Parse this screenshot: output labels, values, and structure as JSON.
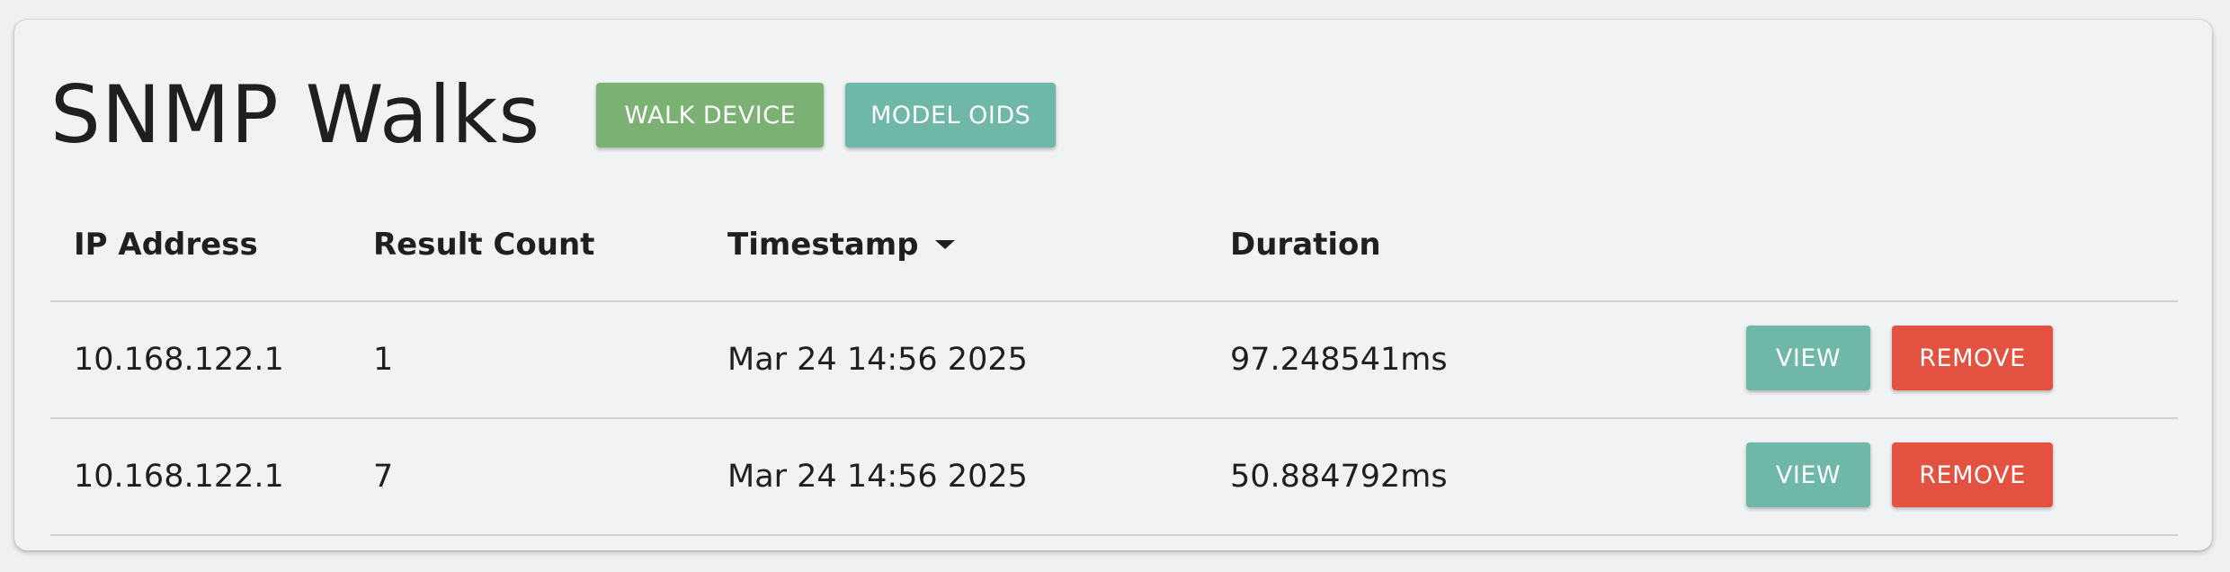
{
  "page": {
    "title": "SNMP Walks"
  },
  "toolbar": {
    "walk_device_label": "WALK DEVICE",
    "model_oids_label": "MODEL OIDS"
  },
  "table": {
    "columns": [
      "IP Address",
      "Result Count",
      "Timestamp",
      "Duration"
    ],
    "sort": {
      "column": "Timestamp",
      "direction": "descending"
    },
    "rows": [
      {
        "ip": "10.168.122.1",
        "count": "1",
        "timestamp": "Mar 24 14:56 2025",
        "duration": "97.248541ms",
        "view_label": "VIEW",
        "remove_label": "REMOVE"
      },
      {
        "ip": "10.168.122.1",
        "count": "7",
        "timestamp": "Mar 24 14:56 2025",
        "duration": "50.884792ms",
        "view_label": "VIEW",
        "remove_label": "REMOVE"
      }
    ]
  },
  "colors": {
    "walk_button": "#7bb274",
    "model_button": "#6fb7a6",
    "view_button": "#6fb7a6",
    "remove_button": "#e35241",
    "card_background": "#f1f2f4",
    "page_background": "#eef0f2"
  },
  "icons": {
    "sort": "sort-desc-icon"
  }
}
